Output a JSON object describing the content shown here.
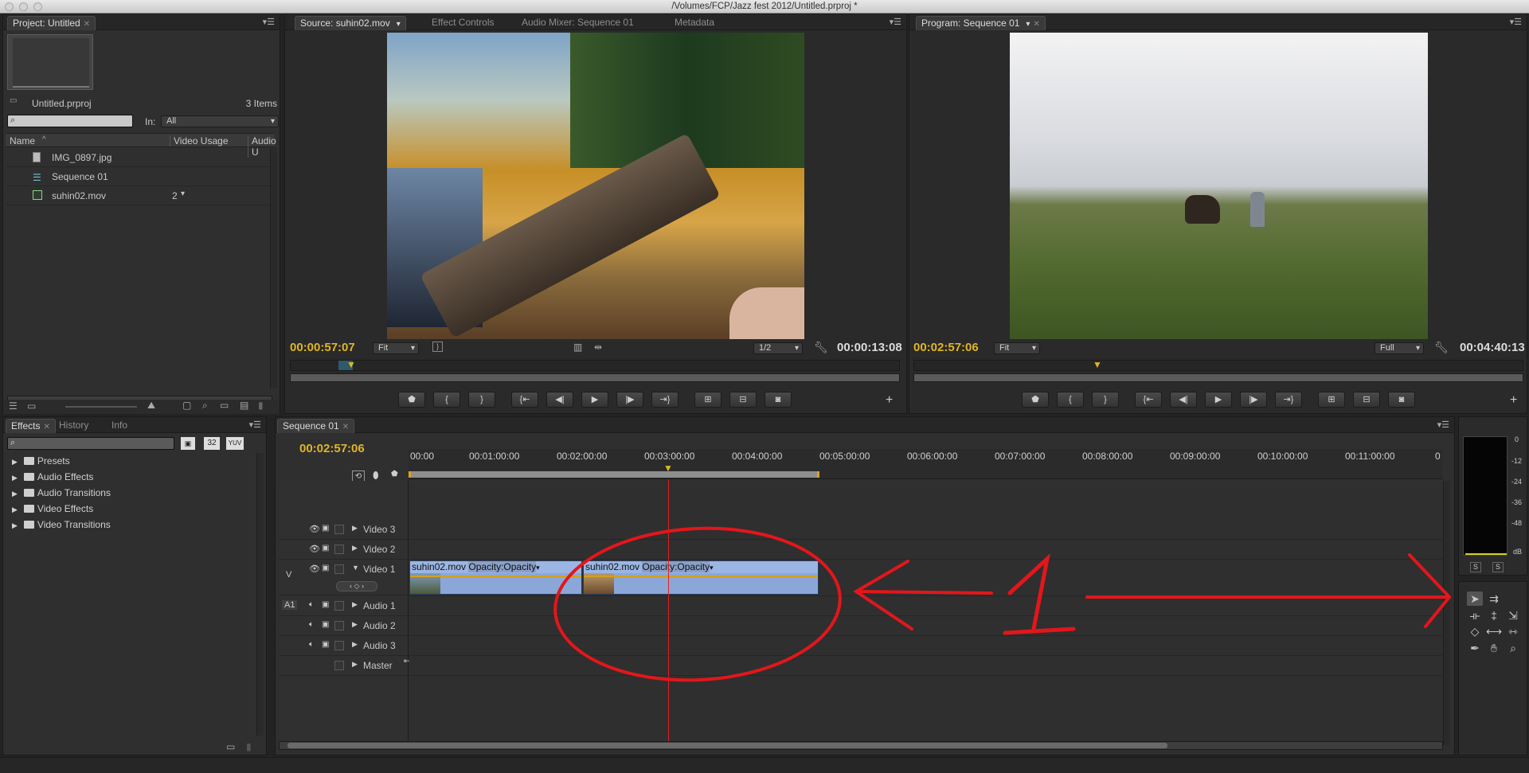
{
  "window": {
    "title": "/Volumes/FCP/Jazz fest 2012/Untitled.prproj *"
  },
  "project": {
    "tab": "Project: Untitled",
    "filename": "Untitled.prproj",
    "item_count": "3 Items",
    "in_label": "In:",
    "in_value": "All",
    "columns": [
      "Name",
      "Video Usage",
      "Audio U"
    ],
    "items": [
      {
        "name": "IMG_0897.jpg",
        "usage": ""
      },
      {
        "name": "Sequence 01",
        "usage": ""
      },
      {
        "name": "suhin02.mov",
        "usage": "2"
      }
    ]
  },
  "source": {
    "tabs": [
      "Source: suhin02.mov",
      "Effect Controls",
      "Audio Mixer: Sequence 01",
      "Metadata"
    ],
    "timecode_current": "00:00:57:07",
    "timecode_duration": "00:00:13:08",
    "zoom": "Fit",
    "resolution": "1/2"
  },
  "program": {
    "tab": "Program: Sequence 01",
    "timecode_current": "00:02:57:06",
    "timecode_duration": "00:04:40:13",
    "zoom": "Fit",
    "resolution": "Full"
  },
  "effects": {
    "tabs": [
      "Effects",
      "History",
      "Info"
    ],
    "badges": [
      "32",
      "YUV"
    ],
    "folders": [
      "Presets",
      "Audio Effects",
      "Audio Transitions",
      "Video Effects",
      "Video Transitions"
    ]
  },
  "sequence": {
    "tab": "Sequence 01",
    "timecode": "00:02:57:06",
    "ruler": [
      "00:00",
      "00:01:00:00",
      "00:02:00:00",
      "00:03:00:00",
      "00:04:00:00",
      "00:05:00:00",
      "00:06:00:00",
      "00:07:00:00",
      "00:08:00:00",
      "00:09:00:00",
      "00:10:00:00",
      "00:11:00:00",
      "0"
    ],
    "video_tracks": [
      "Video 3",
      "Video 2",
      "Video 1"
    ],
    "audio_tracks": [
      "Audio 1",
      "Audio 2",
      "Audio 3",
      "Master"
    ],
    "v_label": "V",
    "a_label": "A1",
    "clips": [
      {
        "name": "suhin02.mov",
        "fx": "Opacity:Opacity"
      },
      {
        "name": "suhin02.mov",
        "fx": "Opacity:Opacity"
      }
    ]
  },
  "meter": {
    "labels": [
      "0",
      "-12",
      "-24",
      "-36",
      "-48",
      "dB"
    ],
    "solo": [
      "S",
      "S"
    ]
  },
  "annotation": {
    "number": "1",
    "color": "#e3161b"
  },
  "colors": {
    "timecode": "#e0b526",
    "clip": "#8aa7d8",
    "playhead": "#e02020"
  }
}
